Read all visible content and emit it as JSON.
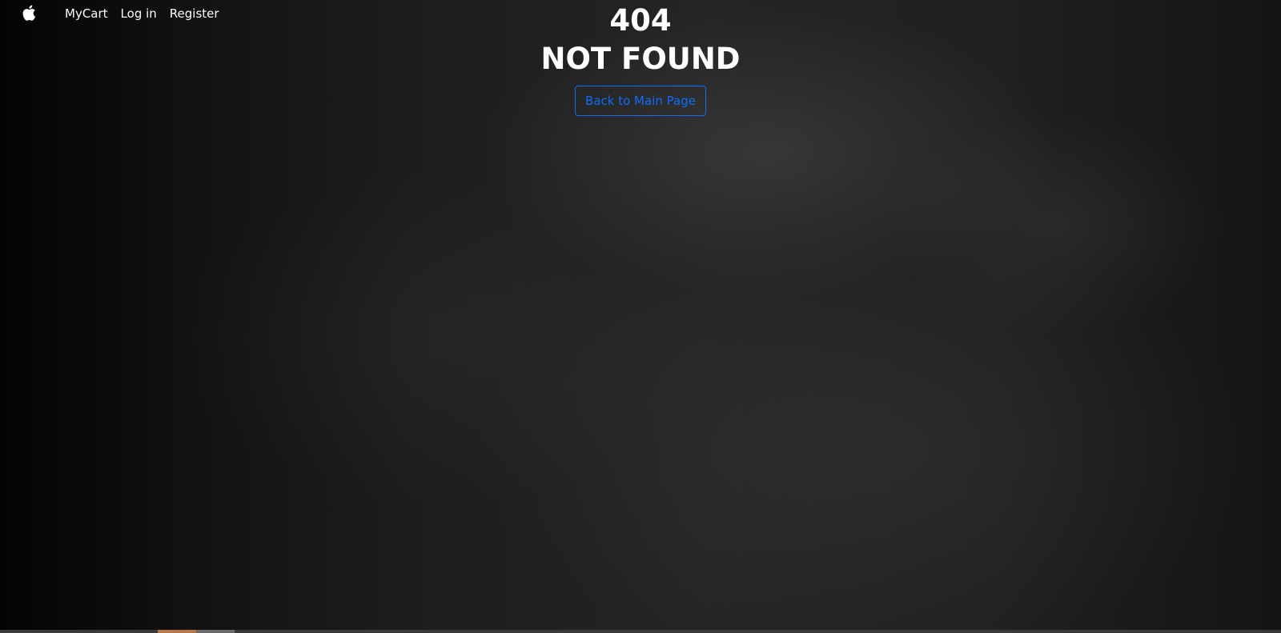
{
  "navbar": {
    "brand_icon": "apple-logo-icon",
    "links": [
      {
        "label": "MyCart"
      },
      {
        "label": "Log in"
      },
      {
        "label": "Register"
      }
    ]
  },
  "error": {
    "code": "404",
    "message": "NOT FOUND",
    "button_label": "Back to Main Page"
  },
  "colors": {
    "text": "#ffffff",
    "button_accent": "#0d6efd",
    "background": "#1e1e1e"
  }
}
